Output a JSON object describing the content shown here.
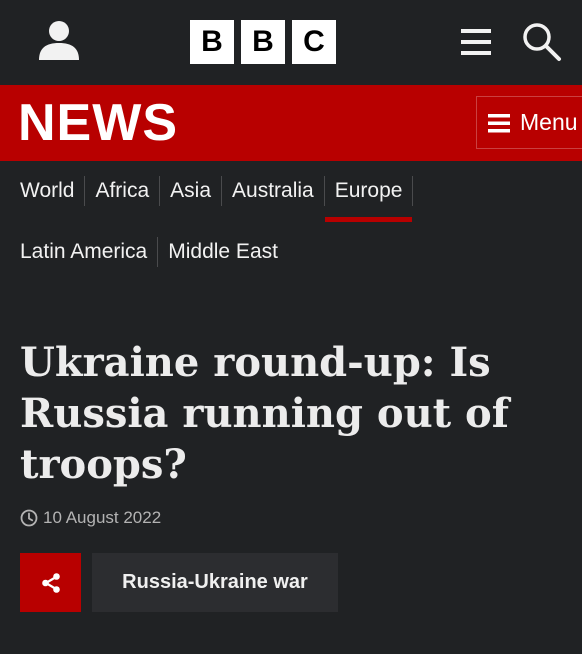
{
  "brand": {
    "logo_letters": [
      "B",
      "B",
      "C"
    ],
    "news_label": "NEWS",
    "accent_color": "#b80000",
    "background_color": "#202224"
  },
  "header": {
    "account_icon": "account-icon",
    "more_icon": "hamburger-icon",
    "search_icon": "search-icon",
    "menu_label": "Menu",
    "menu_icon": "hamburger-icon"
  },
  "nav": {
    "items": [
      {
        "label": "World",
        "active": false
      },
      {
        "label": "Africa",
        "active": false
      },
      {
        "label": "Asia",
        "active": false
      },
      {
        "label": "Australia",
        "active": false
      },
      {
        "label": "Europe",
        "active": true
      },
      {
        "label": "Latin America",
        "active": false
      },
      {
        "label": "Middle East",
        "active": false
      }
    ]
  },
  "article": {
    "headline": "Ukraine round-up: Is Russia running out of troops?",
    "date": "10 August 2022",
    "clock_icon": "clock-icon",
    "share_icon": "share-icon",
    "topic_tag": "Russia-Ukraine war"
  }
}
